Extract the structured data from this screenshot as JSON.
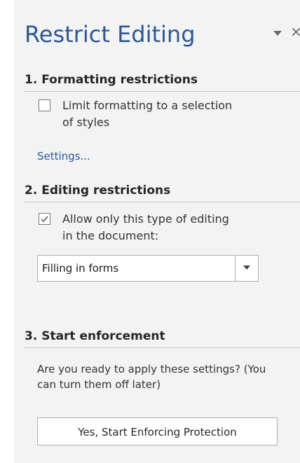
{
  "pane": {
    "title": "Restrict Editing",
    "menu_icon": "chevron-down-icon",
    "close_icon": "close-icon",
    "close_glyph": "×"
  },
  "formatting": {
    "heading": "1. Formatting restrictions",
    "checkbox_checked": false,
    "checkbox_label_line1": "Limit formatting to a selection",
    "checkbox_label_line2": "of styles",
    "settings_link": "Settings..."
  },
  "editing": {
    "heading": "2. Editing restrictions",
    "checkbox_checked": true,
    "checkbox_label_line1": "Allow only this type of editing",
    "checkbox_label_line2": "in the document:",
    "dropdown_value": "Filling in forms"
  },
  "enforcement": {
    "heading": "3. Start enforcement",
    "description": "Are you ready to apply these settings? (You can turn them off later)",
    "button_label": "Yes, Start Enforcing Protection"
  },
  "colors": {
    "accent": "#2b579a",
    "pane_background": "#f3f3f3"
  }
}
